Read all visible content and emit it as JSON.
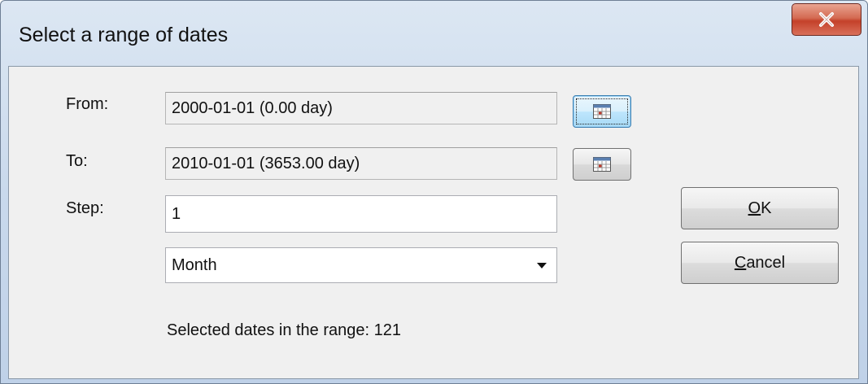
{
  "window": {
    "title": "Select a range of dates",
    "close_glyph": "X"
  },
  "form": {
    "from_label": "From:",
    "from_value": "2000-01-01 (0.00 day)",
    "to_label": "To:",
    "to_value": "2010-01-01 (3653.00 day)",
    "step_label": "Step:",
    "step_value": "1",
    "unit_selected": "Month",
    "summary": "Selected dates in the range: 121"
  },
  "buttons": {
    "ok_mnemonic": "O",
    "ok_rest": "K",
    "cancel_mnemonic": "C",
    "cancel_rest": "ancel"
  },
  "icons": {
    "calendar": "calendar-icon",
    "dropdown": "chevron-down-icon",
    "close": "close-icon"
  }
}
